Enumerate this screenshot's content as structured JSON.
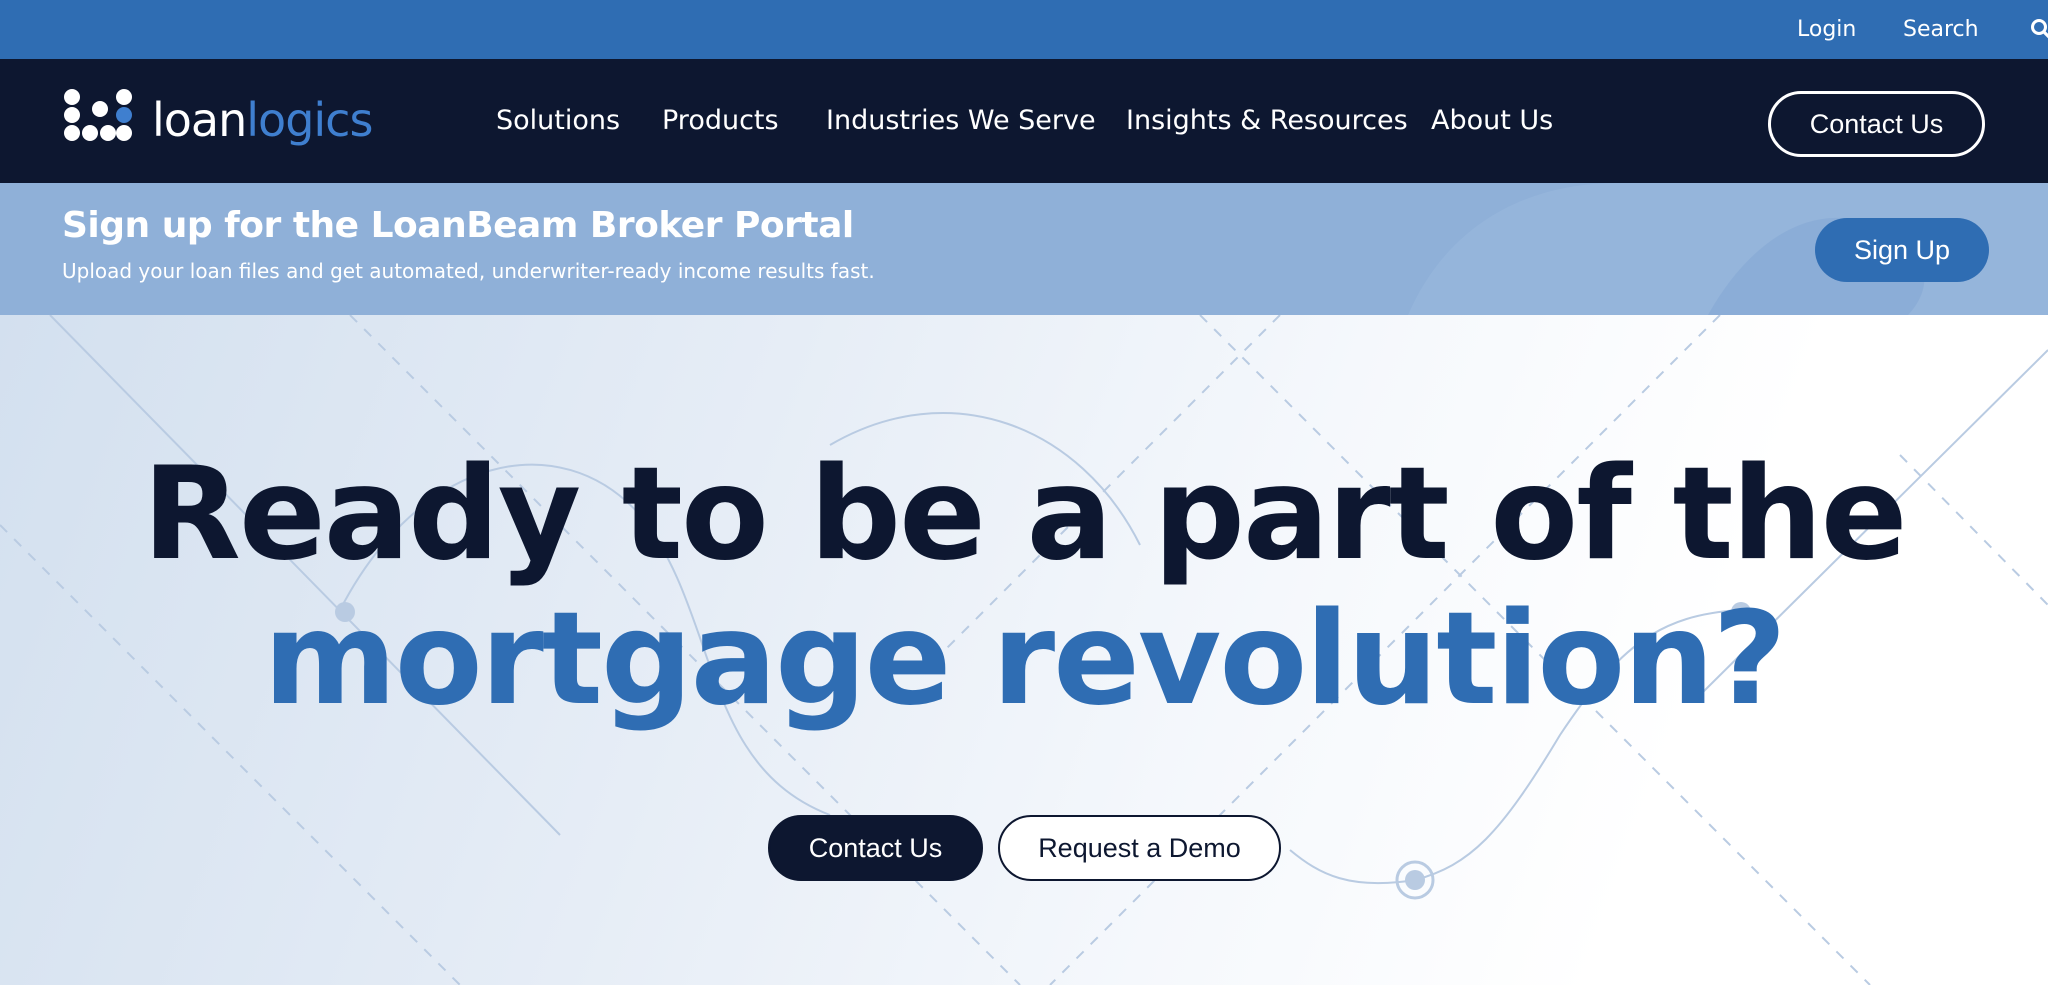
{
  "utility": {
    "login": "Login",
    "search": "Search"
  },
  "brand": {
    "loan": "loan",
    "logics": "logics"
  },
  "nav": {
    "items": [
      "Solutions",
      "Products",
      "Industries We Serve",
      "Insights & Resources",
      "About Us"
    ],
    "contact": "Contact Us"
  },
  "banner": {
    "title": "Sign up for the LoanBeam Broker Portal",
    "subtitle": "Upload your loan files and get automated, underwriter-ready income results fast.",
    "button": "Sign Up"
  },
  "hero": {
    "line1": "Ready to be a part of the",
    "line2": "mortgage revolution?",
    "contact_button": "Contact Us",
    "demo_button": "Request a Demo"
  },
  "colors": {
    "primary_blue": "#2f6db3",
    "navy": "#0d1730",
    "banner_blue": "#8fb0d8"
  }
}
